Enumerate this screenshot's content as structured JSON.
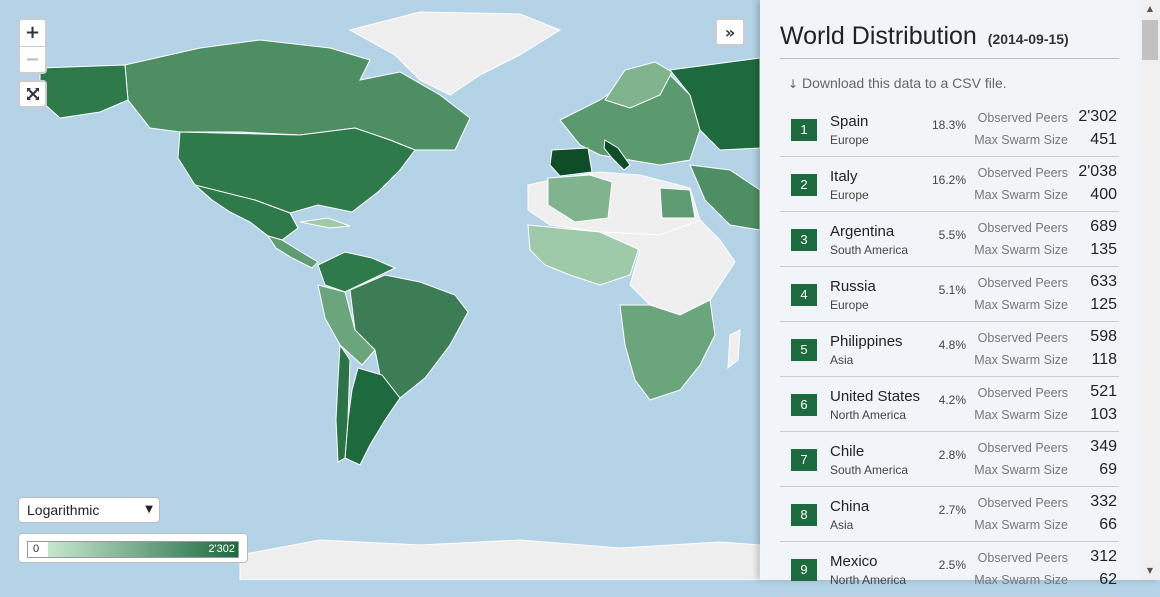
{
  "map": {
    "zoom_in": "+",
    "zoom_out": "−",
    "scale_select": {
      "selected": "Logarithmic"
    },
    "legend": {
      "min": "0",
      "max": "2'302"
    },
    "colors": {
      "ocean": "#b5d3e7",
      "no_data": "#efefef",
      "light": "#c7e6cf",
      "dark": "#1d6a3e",
      "darkest": "#0e4d27"
    }
  },
  "panel": {
    "title": "World Distribution",
    "date": "(2014-09-15)",
    "download_text": "Download this data to a CSV file.",
    "peers_label": "Observed Peers",
    "swarm_label": "Max Swarm Size",
    "rows": [
      {
        "rank": "1",
        "country": "Spain",
        "continent": "Europe",
        "pct": "18.3%",
        "peers": "2'302",
        "swarm": "451"
      },
      {
        "rank": "2",
        "country": "Italy",
        "continent": "Europe",
        "pct": "16.2%",
        "peers": "2'038",
        "swarm": "400"
      },
      {
        "rank": "3",
        "country": "Argentina",
        "continent": "South America",
        "pct": "5.5%",
        "peers": "689",
        "swarm": "135"
      },
      {
        "rank": "4",
        "country": "Russia",
        "continent": "Europe",
        "pct": "5.1%",
        "peers": "633",
        "swarm": "125"
      },
      {
        "rank": "5",
        "country": "Philippines",
        "continent": "Asia",
        "pct": "4.8%",
        "peers": "598",
        "swarm": "118"
      },
      {
        "rank": "6",
        "country": "United States",
        "continent": "North America",
        "pct": "4.2%",
        "peers": "521",
        "swarm": "103"
      },
      {
        "rank": "7",
        "country": "Chile",
        "continent": "South America",
        "pct": "2.8%",
        "peers": "349",
        "swarm": "69"
      },
      {
        "rank": "8",
        "country": "China",
        "continent": "Asia",
        "pct": "2.7%",
        "peers": "332",
        "swarm": "66"
      },
      {
        "rank": "9",
        "country": "Mexico",
        "continent": "North America",
        "pct": "2.5%",
        "peers": "312",
        "swarm": "62"
      }
    ]
  }
}
